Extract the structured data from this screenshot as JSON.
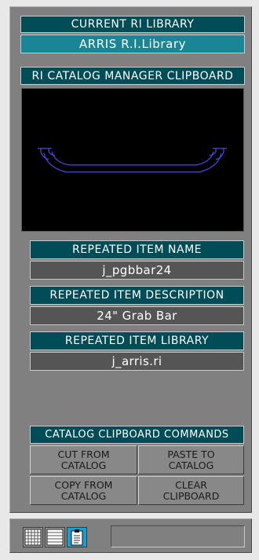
{
  "library": {
    "header": "CURRENT RI LIBRARY",
    "value": "ARRIS R.I.Library"
  },
  "clipboard": {
    "header": "RI CATALOG MANAGER CLIPBOARD"
  },
  "item_name": {
    "header": "REPEATED ITEM NAME",
    "value": "j_pgbbar24"
  },
  "item_description": {
    "header": "REPEATED ITEM DESCRIPTION",
    "value": "24\" Grab Bar"
  },
  "item_library": {
    "header": "REPEATED ITEM LIBRARY",
    "value": "j_arris.ri"
  },
  "commands": {
    "header": "CATALOG CLIPBOARD COMMANDS",
    "cut": [
      "CUT FROM",
      "CATALOG"
    ],
    "paste": [
      "PASTE TO",
      "CATALOG"
    ],
    "copy": [
      "COPY FROM",
      "CATALOG"
    ],
    "clear": [
      "CLEAR",
      "CLIPBOARD"
    ]
  },
  "toolbar": {
    "buttons": [
      {
        "icon": "grid-view-icon"
      },
      {
        "icon": "list-view-icon"
      },
      {
        "icon": "clipboard-icon",
        "active": true
      }
    ]
  },
  "colors": {
    "header_bg": "#004c57",
    "library_value_bg": "#1a8597",
    "value_bg": "#555555",
    "preview_stroke": "#4a4ae6",
    "active_button": "#1a9fd0"
  }
}
